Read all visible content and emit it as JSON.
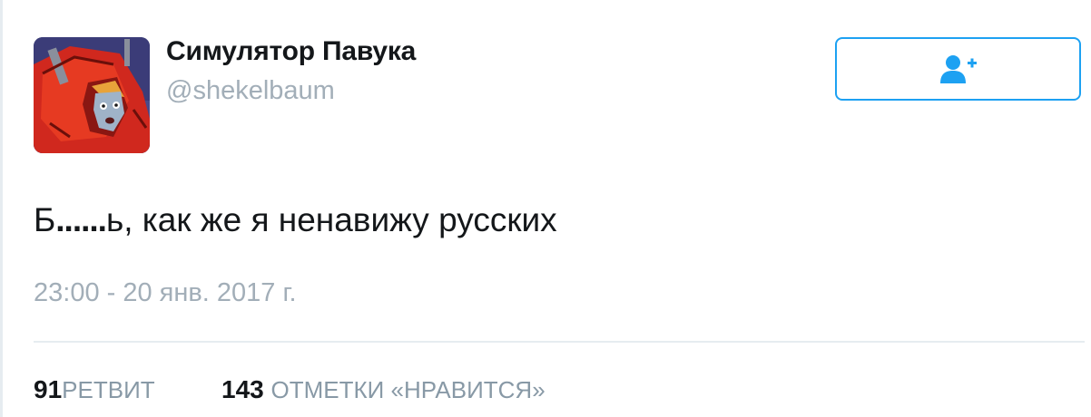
{
  "profile": {
    "name": "Симулятор Павука",
    "handle": "@shekelbaum"
  },
  "follow_button": {
    "icon": "follow-user-icon",
    "color": "#1da1f2"
  },
  "tweet": {
    "text_first": "Б",
    "text_censor": "......",
    "text_rest": "ь, как же я ненавижу русских",
    "timestamp": "23:00 - 20 янв. 2017 г."
  },
  "stats": {
    "retweets_count": "91",
    "retweets_label": "РЕТВИТ",
    "likes_count": "143",
    "likes_label": "ОТМЕТКИ «НРАВИТСЯ»"
  }
}
